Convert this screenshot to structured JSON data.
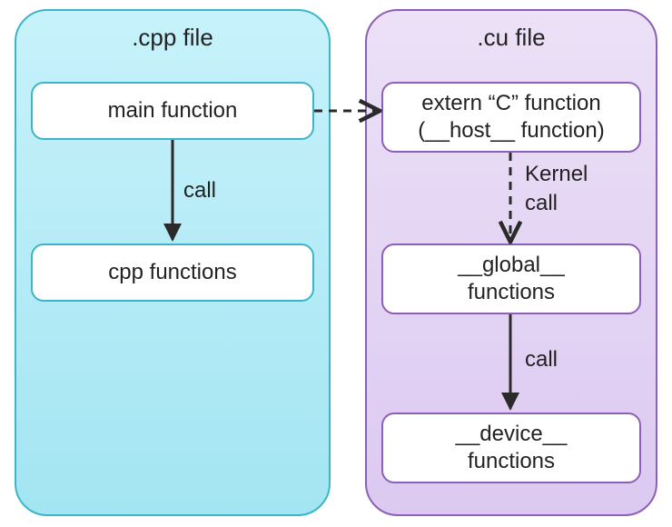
{
  "diagram": {
    "left_panel": {
      "title": ".cpp file",
      "box_main": "main function",
      "box_cpp": "cpp functions",
      "edge_main_to_cpp": "call"
    },
    "right_panel": {
      "title": ".cu file",
      "box_extern_line1": "extern “C” function",
      "box_extern_line2": "(__host__ function)",
      "box_global_line1": "__global__",
      "box_global_line2": "functions",
      "box_device_line1": "__device__",
      "box_device_line2": "functions",
      "edge_extern_to_global_line1": "Kernel",
      "edge_extern_to_global_line2": "call",
      "edge_global_to_device": "call"
    },
    "edge_main_to_extern": ""
  }
}
